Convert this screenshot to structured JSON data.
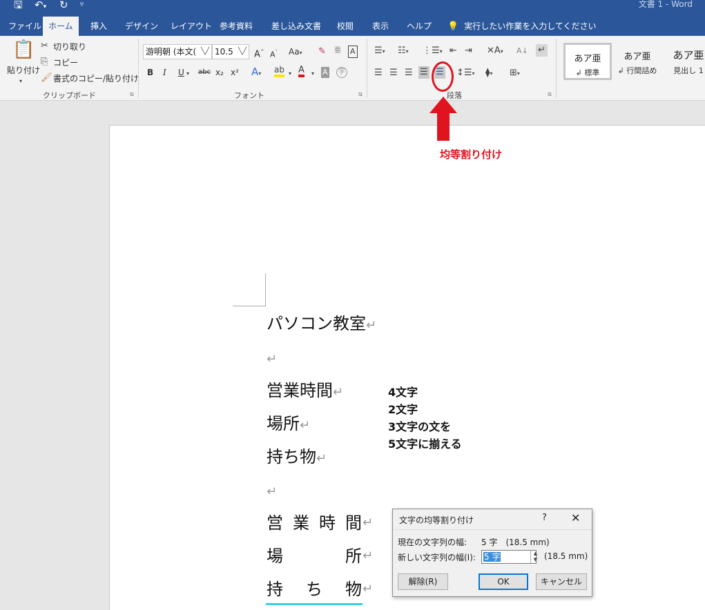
{
  "window": {
    "title": "文書 1  -  Word"
  },
  "tabs": [
    {
      "label": "ファイル",
      "active": false
    },
    {
      "label": "ホーム",
      "active": true
    },
    {
      "label": "挿入",
      "active": false
    },
    {
      "label": "デザイン",
      "active": false
    },
    {
      "label": "レイアウト",
      "active": false
    },
    {
      "label": "参考資料",
      "active": false
    },
    {
      "label": "差し込み文書",
      "active": false
    },
    {
      "label": "校閲",
      "active": false
    },
    {
      "label": "表示",
      "active": false
    },
    {
      "label": "ヘルプ",
      "active": false
    }
  ],
  "tell_me": "実行したい作業を入力してください",
  "ribbon": {
    "clipboard": {
      "paste": "貼り付け",
      "cut": "切り取り",
      "copy": "コピー",
      "format_painter": "書式のコピー/貼り付け",
      "label": "クリップボード"
    },
    "font": {
      "font_name": "游明朝 (本文(",
      "font_size": "10.5",
      "bold": "B",
      "italic": "I",
      "underline": "U",
      "strike": "abc",
      "subscript": "x₂",
      "superscript": "x²",
      "grow": "A",
      "shrink": "A",
      "case": "Aa",
      "label": "フォント"
    },
    "paragraph": {
      "label": "段落"
    },
    "styles": [
      {
        "sample": "あア亜",
        "name": "標準"
      },
      {
        "sample": "あア亜",
        "name": "行間詰め"
      },
      {
        "sample": "あア亜",
        "name": "見出し 1"
      }
    ]
  },
  "annotation": {
    "label": "均等割り付け",
    "color": "#e0141e"
  },
  "document": {
    "title_line": "パソコン教室",
    "lines_before": [
      "営業時間",
      "場所",
      "持ち物"
    ],
    "lines_after": [
      [
        "営",
        "業",
        "時",
        "間"
      ],
      [
        "場",
        "所"
      ],
      [
        "持",
        "ち",
        "物"
      ]
    ],
    "notes": [
      "4文字",
      "2文字",
      "3文字の文を",
      "5文字に揃える"
    ],
    "paragraph_mark": "↵"
  },
  "dialog": {
    "title": "文字の均等割り付け",
    "help": "?",
    "close": "✕",
    "current_label": "現在の文字列の幅:",
    "current_value": "5 字　(18.5 mm)",
    "new_label": "新しい文字列の幅(I):",
    "new_value": "5 字",
    "new_mm": "(18.5 mm)",
    "remove_button": "解除(R)",
    "ok_button": "OK",
    "cancel_button": "キャンセル"
  }
}
